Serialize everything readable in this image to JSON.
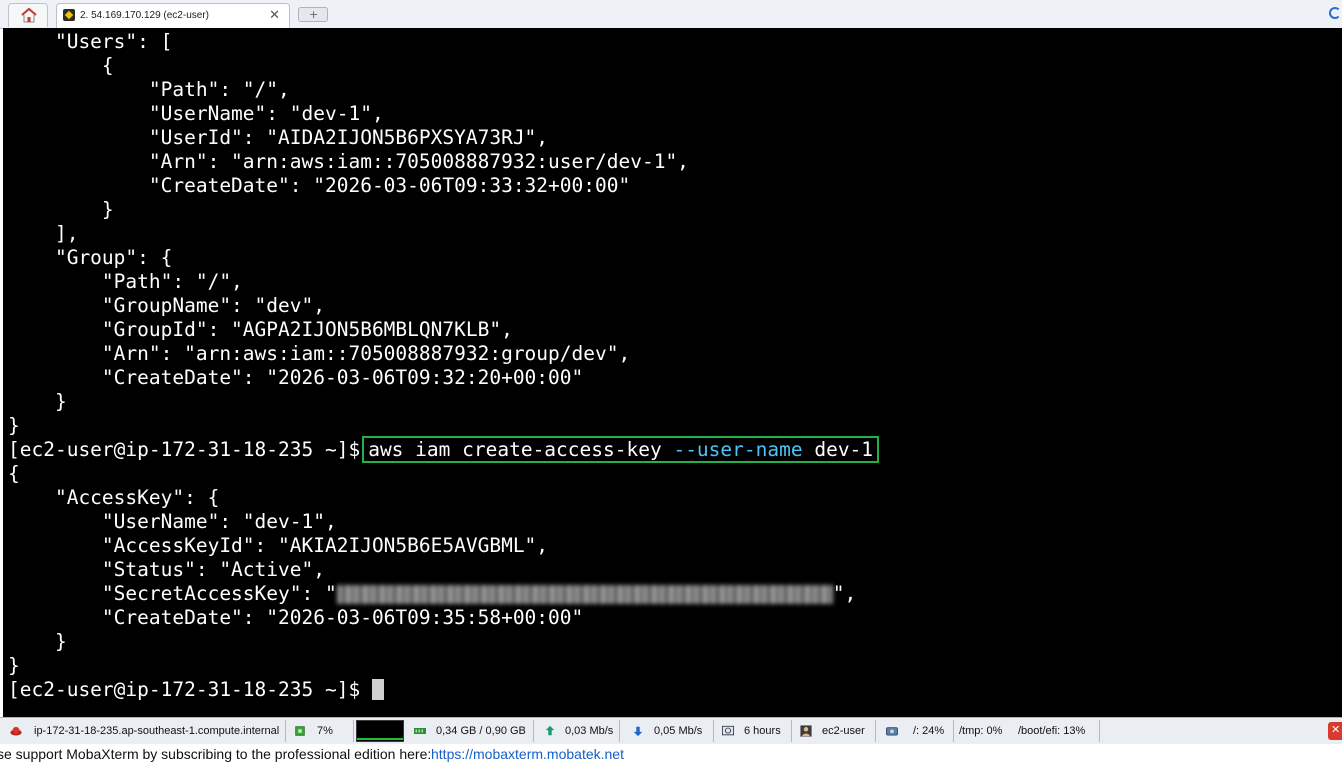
{
  "tabs": {
    "home_icon": "home-icon",
    "session_title": "2. 54.169.170.129 (ec2-user)",
    "close_glyph": "✕",
    "new_tab_glyph": "+"
  },
  "terminal": {
    "lines": [
      "    \"Users\": [",
      "        {",
      "            \"Path\": \"/\",",
      "            \"UserName\": \"dev-1\",",
      "            \"UserId\": \"AIDA2IJON5B6PXSYA73RJ\",",
      "            \"Arn\": \"arn:aws:iam::705008887932:user/dev-1\",",
      "            \"CreateDate\": \"2026-03-06T09:33:32+00:00\"",
      "        }",
      "    ],",
      "    \"Group\": {",
      "        \"Path\": \"/\",",
      "        \"GroupName\": \"dev\",",
      "        \"GroupId\": \"AGPA2IJON5B6MBLQN7KLB\",",
      "        \"Arn\": \"arn:aws:iam::705008887932:group/dev\",",
      "        \"CreateDate\": \"2026-03-06T09:32:20+00:00\"",
      "    }",
      "}"
    ],
    "prompt": "[ec2-user@ip-172-31-18-235 ~]$",
    "command_main": "aws iam create-access-key ",
    "command_option": "--user-name",
    "command_arg": " dev-1",
    "output_lines": [
      "{",
      "    \"AccessKey\": {",
      "        \"UserName\": \"dev-1\",",
      "        \"AccessKeyId\": \"AKIA2IJON5B6E5AVGBML\",",
      "        \"Status\": \"Active\","
    ],
    "secret_key_prefix": "        \"SecretAccessKey\": \"",
    "secret_key_suffix": "\",",
    "output_tail": [
      "        \"CreateDate\": \"2026-03-06T09:35:58+00:00\"",
      "    }",
      "}"
    ],
    "final_prompt": "[ec2-user@ip-172-31-18-235 ~]$ ",
    "colors": {
      "background": "#000000",
      "text": "#ffffff",
      "option": "#4fc3f7",
      "highlight_box": "#22b04a"
    }
  },
  "statusbar": {
    "hostname": "ip-172-31-18-235.ap-southeast-1.compute.internal",
    "cpu": "7%",
    "memory": "0,34 GB / 0,90 GB",
    "upload": "0,03 Mb/s",
    "download": "0,05 Mb/s",
    "uptime": "6 hours",
    "user": "ec2-user",
    "disk_root": "/: 24%",
    "disk_tmp": "/tmp: 0%",
    "disk_boot": "/boot/efi: 13%"
  },
  "footer": {
    "text": "se support MobaXterm by subscribing to the professional edition here:",
    "link": "https://mobaxterm.mobatek.net"
  }
}
